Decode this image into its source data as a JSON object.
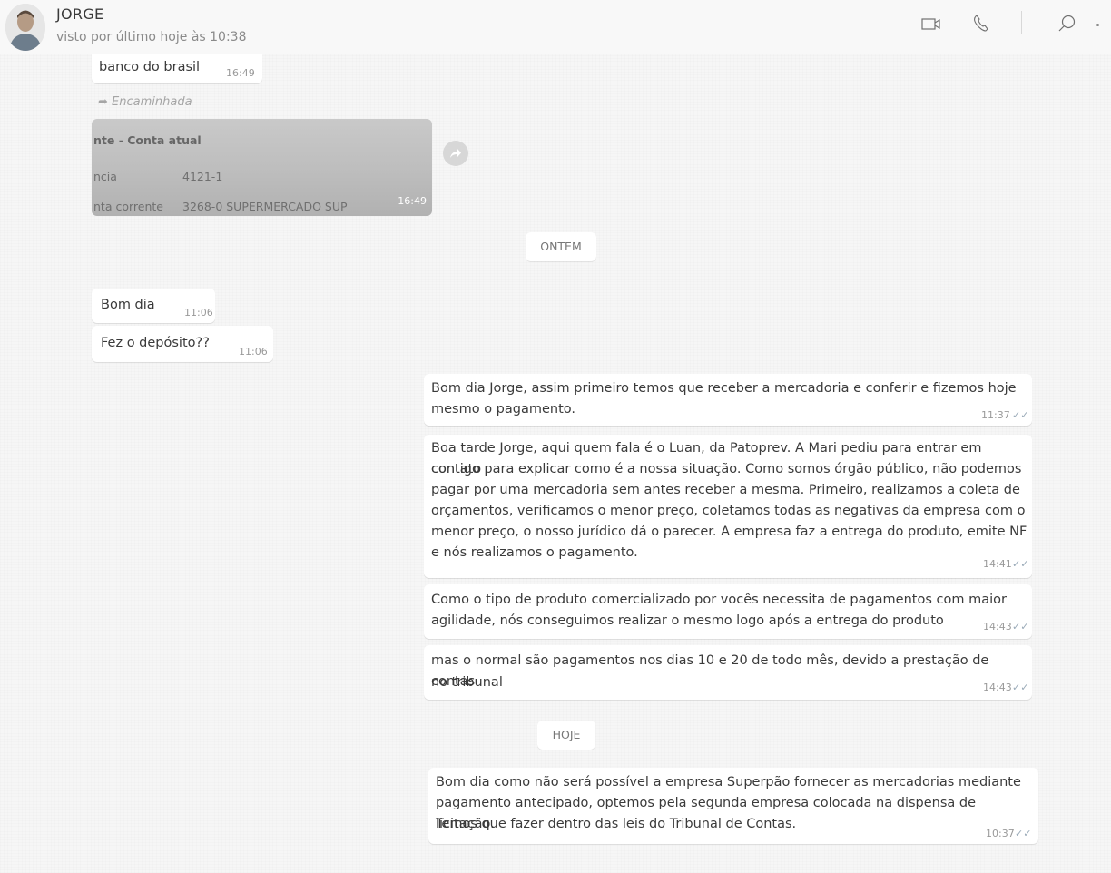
{
  "header": {
    "contact_name": "JORGE",
    "last_seen": "visto por último hoje às 10:38",
    "icons": [
      "video-call-icon",
      "voice-call-icon",
      "search-icon",
      "menu-icon"
    ]
  },
  "messages": {
    "partial_top": {
      "text": "banco do brasil",
      "time": "16:49"
    },
    "forwarded_label": "Encaminhada",
    "image_message": {
      "line1": "nte - Conta atual",
      "line2_label": "ncia",
      "line2_value": "4121-1",
      "line3_label": "nta corrente",
      "line3_value": "3268-0 SUPERMERCADO SUP",
      "time": "16:49"
    },
    "day_ontem": "ONTEM",
    "in1": {
      "text": "Bom dia",
      "time": "11:06"
    },
    "in2": {
      "text": "Fez o depósito??",
      "time": "11:06"
    },
    "out1": {
      "line1": "Bom dia Jorge, assim primeiro temos que receber a mercadoria e conferir e fizemos hoje",
      "line2": "mesmo o pagamento.",
      "time": "11:37"
    },
    "out2": {
      "line1": "Boa tarde Jorge, aqui quem fala é o Luan, da Patoprev. A Mari pediu para entrar em contato",
      "line2": "contigo para explicar como é a nossa situação. Como somos órgão público, não podemos",
      "line3": "pagar por uma mercadoria sem antes receber a mesma. Primeiro, realizamos a coleta de",
      "line4": "orçamentos, verificamos o menor preço, coletamos todas as negativas da empresa com o",
      "line5": "menor preço, o nosso jurídico dá o parecer. A empresa faz a entrega do produto, emite NF",
      "line6": "e nós realizamos o pagamento.",
      "time": "14:41"
    },
    "out3": {
      "line1": "Como o tipo de produto comercializado por vocês necessita de pagamentos com maior",
      "line2": "agilidade, nós conseguimos realizar o mesmo logo após a entrega do produto",
      "time": "14:43"
    },
    "out4": {
      "line1": "mas o normal são pagamentos nos dias 10 e 20 de todo mês, devido a prestação de contas",
      "line2": "no tribunal",
      "time": "14:43"
    },
    "day_hoje": "HOJE",
    "out5": {
      "line1": "Bom dia como não será possível a empresa Superpão fornecer as mercadorias mediante",
      "line2": "pagamento antecipado, optemos pela segunda empresa colocada na dispensa de licitação.",
      "line3": "Temos que fazer dentro das leis do Tribunal de Contas.",
      "time": "10:37"
    },
    "read_ticks": "✓✓"
  },
  "colors": {
    "background": "#f6f6f6",
    "bubble": "#ffffff",
    "ticks": "#9aaab8"
  }
}
